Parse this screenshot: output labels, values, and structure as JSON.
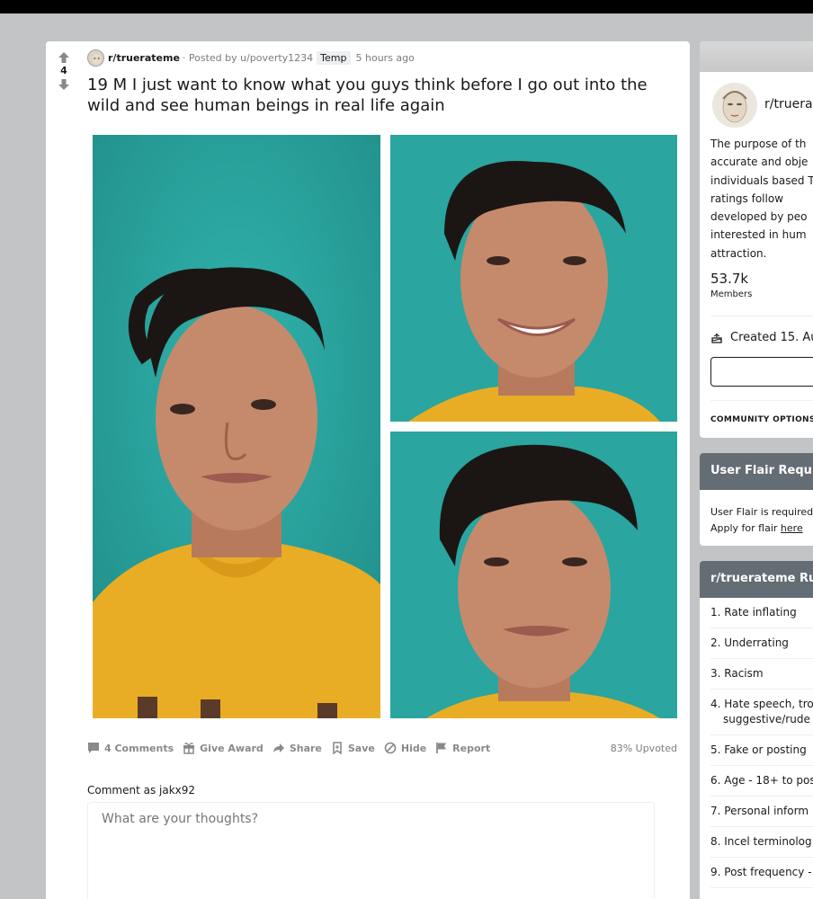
{
  "post": {
    "score": "4",
    "subreddit": "r/truerateme",
    "posted_by": "· Posted by u/poverty1234",
    "user_flair": "Temp",
    "time_ago": "5 hours ago",
    "title": "19 M I just want to know what you guys think before I go out into the wild and see human beings in real life again",
    "actions": {
      "comments": "4 Comments",
      "give_award": "Give Award",
      "share": "Share",
      "save": "Save",
      "hide": "Hide",
      "report": "Report"
    },
    "upvoted": "83% Upvoted",
    "comment_as": "Comment as jakx92",
    "comment_placeholder": "What are your thoughts?"
  },
  "sidebar": {
    "about": {
      "name": "r/truera",
      "description": "The purpose of th accurate and obje individuals based The ratings follow developed by peo interested in hum attraction.",
      "members_count": "53.7k",
      "members_label": "Members",
      "created": "Created 15. Au",
      "community_options": "COMMUNITY OPTIONS"
    },
    "flair": {
      "title": "User Flair Requir",
      "line1": "User Flair is required",
      "line2_prefix": "Apply for flair ",
      "line2_link": "here"
    },
    "rules": {
      "title": "r/truerateme Rul",
      "items": [
        "1. Rate inflating",
        "2. Underrating",
        "3. Racism",
        "4. Hate speech, tro",
        "suggestive/rude",
        "5. Fake or posting",
        "6. Age - 18+ to pos",
        "7. Personal inform",
        "8. Incel terminolog",
        "9. Post frequency -"
      ]
    }
  },
  "colors": {
    "page_bg": "#c3c4c6",
    "photo_bg": "#2aa59f",
    "shirt": "#e9ad25",
    "widget_header": "#646d73"
  }
}
